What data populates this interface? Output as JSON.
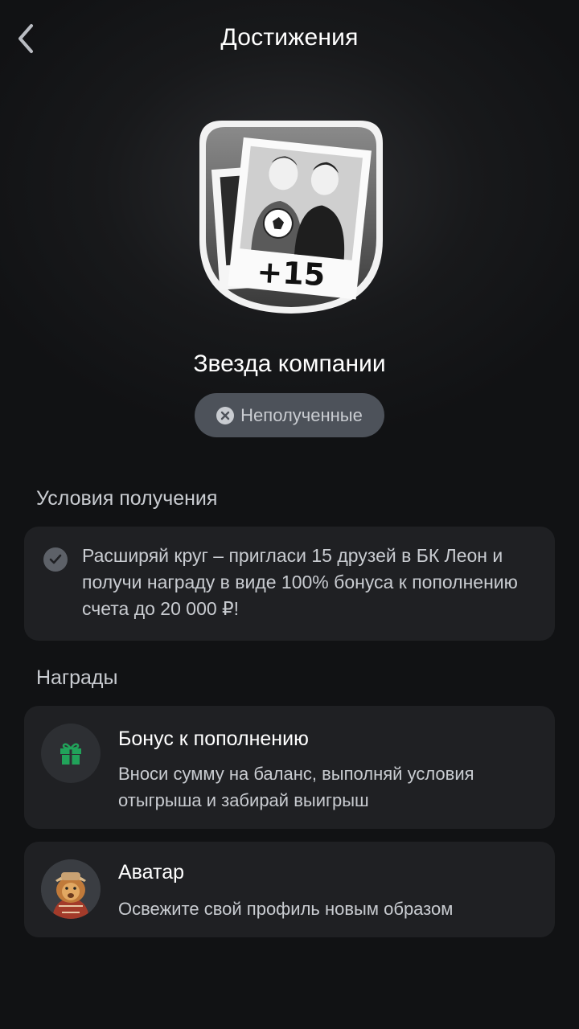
{
  "header": {
    "title": "Достижения",
    "back_icon": "chevron-left-icon"
  },
  "achievement": {
    "badge_text": "+15",
    "name": "Звезда компании",
    "status": "Неполученные",
    "status_icon": "x-circle-icon"
  },
  "conditions": {
    "title": "Условия получения",
    "text": "Расширяй круг – пригласи 15 друзей в БК Леон и получи награду в виде 100% бонуса к пополнению счета до 20 000 ₽!"
  },
  "rewards": {
    "title": "Награды",
    "items": [
      {
        "title": "Бонус к пополнению",
        "description": "Вноси сумму на баланс, выполняй условия отыгрыша и забирай выигрыш",
        "icon": "gift-icon"
      },
      {
        "title": "Аватар",
        "description": "Освежите свой профиль новым образом",
        "icon": "lion-avatar-icon"
      }
    ]
  },
  "colors": {
    "background": "#111214",
    "card": "#1f2023",
    "gift": "#21a35a",
    "pill": "#4d525a"
  }
}
